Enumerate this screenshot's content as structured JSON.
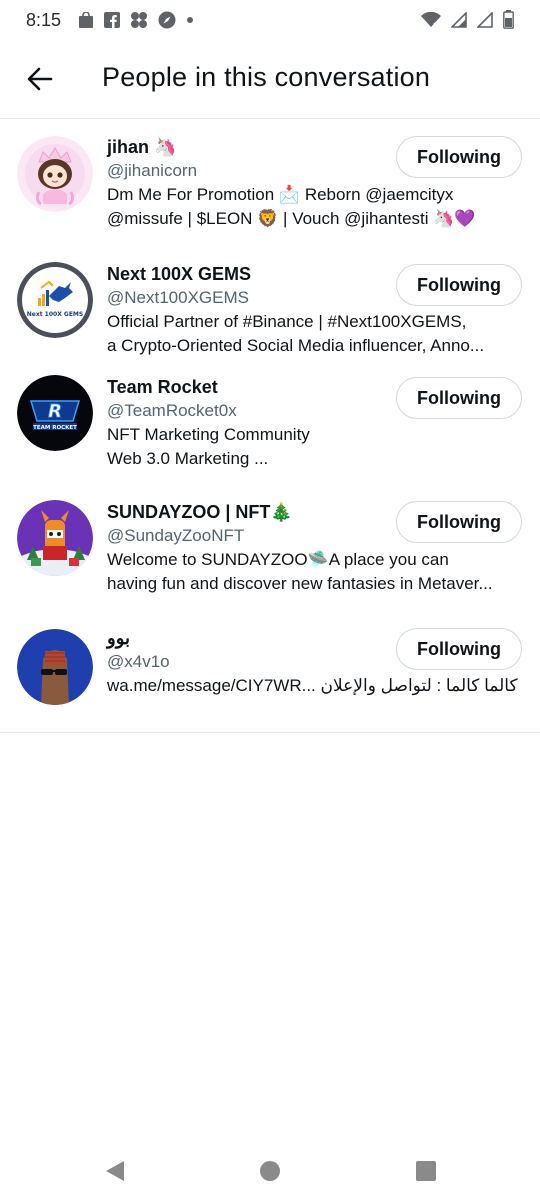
{
  "status_bar": {
    "time": "8:15",
    "left_icons": [
      "shopping-bag-icon",
      "facebook-icon",
      "pinwheel-icon",
      "compass-icon",
      "dot-icon"
    ],
    "right_icons": [
      "wifi-icon",
      "signal-icon",
      "signal-icon",
      "battery-icon"
    ]
  },
  "header": {
    "title": "People in this conversation",
    "back_icon": "arrow-left-icon"
  },
  "people": [
    {
      "name": "jihan 🦄",
      "handle": "@jihanicorn",
      "bio_line1": "Dm Me For Promotion 📩 Reborn @jaemcityx",
      "bio_line2": "@missufe | $LEON 🦁 | Vouch @jihantesti 🦄💜",
      "button": "Following"
    },
    {
      "name": "Next 100X GEMS",
      "handle": "@Next100XGEMS",
      "bio_line1": "Official Partner of #Binance | #Next100XGEMS,",
      "bio_line2": "a Crypto-Oriented Social Media influencer, Anno...",
      "button": "Following",
      "avatar_text": "Next 100X GEMS"
    },
    {
      "name": "Team Rocket",
      "handle": "@TeamRocket0x",
      "bio_line1": "NFT Marketing Community",
      "bio_line2": "Web 3.0 Marketing ...",
      "button": "Following",
      "avatar_text": "TEAM ROCKET"
    },
    {
      "name": "SUNDAYZOO | NFT🎄",
      "handle": "@SundayZooNFT",
      "bio_line1": "Welcome to SUNDAYZOO🛸A place you can",
      "bio_line2": "having fun and discover new fantasies in Metaver...",
      "button": "Following"
    },
    {
      "name": "بوو",
      "handle": "@x4v1o",
      "bio_line1": "wa.me/message/CIY7WR... كالما كالما : لتواصل والإعلان",
      "button": "Following"
    }
  ],
  "nav_bar": {
    "icons": [
      "triangle-back-icon",
      "circle-home-icon",
      "square-recents-icon"
    ]
  },
  "colors": {
    "text_primary": "#0f1419",
    "text_secondary": "#536471",
    "border": "#cfd9de"
  }
}
